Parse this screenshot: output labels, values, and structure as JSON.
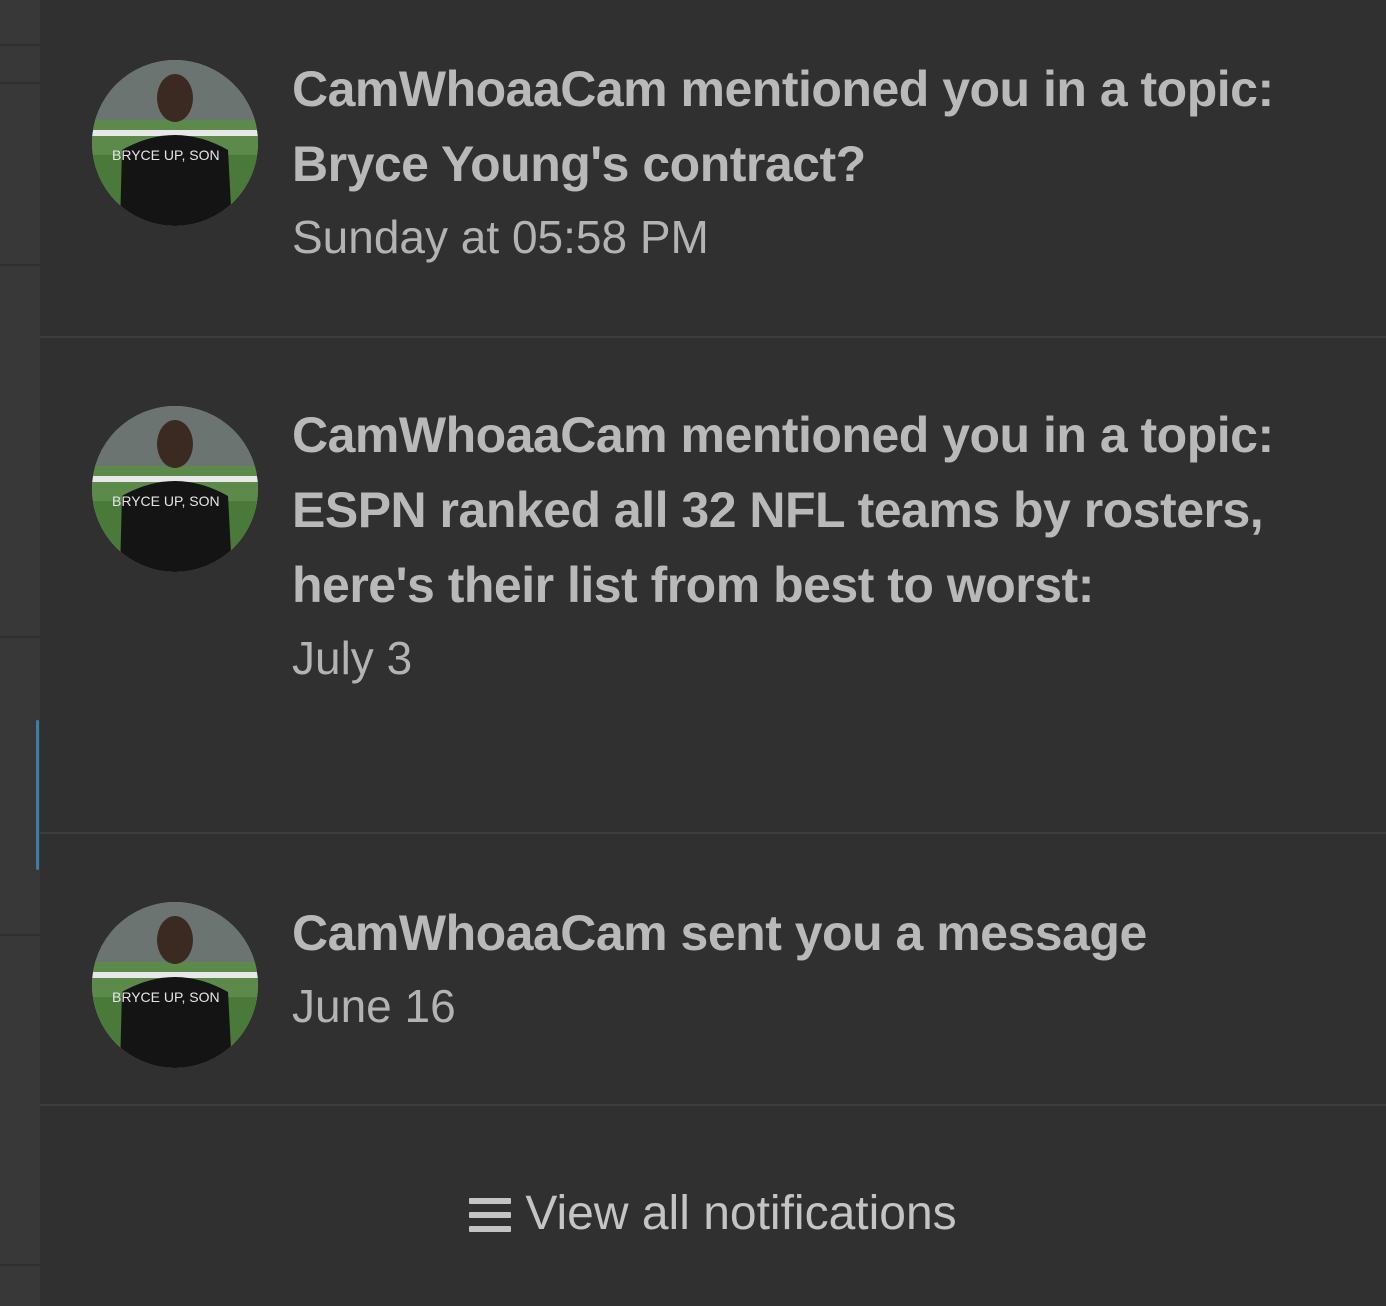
{
  "notifications": [
    {
      "title": "CamWhoaaCam mentioned you in a topic: Bryce Young's contract?",
      "time": "Sunday at 05:58 PM",
      "avatar_shirt_text": "BRYCE UP, SON"
    },
    {
      "title": "CamWhoaaCam mentioned you in a topic: ESPN ranked all 32 NFL teams by rosters, here's their list from best to worst:",
      "time": "July 3",
      "avatar_shirt_text": "BRYCE UP, SON"
    },
    {
      "title": "CamWhoaaCam sent you a message",
      "time": "June 16",
      "avatar_shirt_text": "BRYCE UP, SON"
    }
  ],
  "footer": {
    "icon": "list-icon",
    "label": "View all notifications"
  },
  "colors": {
    "background": "#303030",
    "title_text": "#b9b9b9",
    "time_text": "#b3b3b3",
    "divider": "#3d3d3d",
    "accent": "#3b7ea6"
  }
}
